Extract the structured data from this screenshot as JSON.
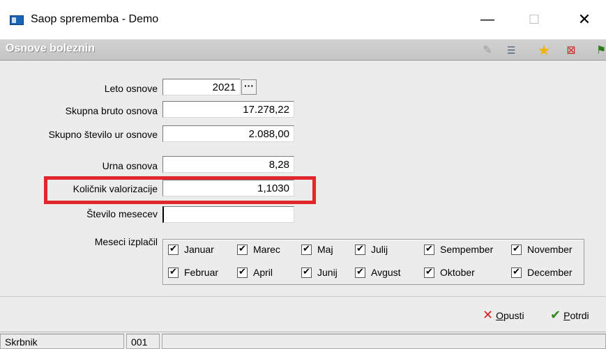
{
  "window": {
    "title": "Saop sprememba - Demo",
    "minimize_glyph": "—",
    "maximize_glyph": "☐",
    "close_glyph": "✕"
  },
  "header": {
    "title": "Osnove boleznin",
    "toolbar_icons": [
      "edit-icon",
      "list-icon",
      "star-icon",
      "delete-icon",
      "exit-icon"
    ]
  },
  "form": {
    "leto_osnove": {
      "label": "Leto osnove",
      "value": "2021",
      "button": "···"
    },
    "skupna_bruto_osnova": {
      "label": "Skupna bruto osnova",
      "value": "17.278,22"
    },
    "skupno_stevilo_ur": {
      "label": "Skupno število ur osnove",
      "value": "2.088,00"
    },
    "urna_osnova": {
      "label": "Urna osnova",
      "value": "8,28"
    },
    "kolicnik_valorizacije": {
      "label": "Količnik valorizacije",
      "value": "1,1030"
    },
    "stevilo_mesecev": {
      "label": "Število mesecev",
      "value": ""
    },
    "meseci_izplacil": {
      "label": "Meseci izplačil",
      "months": [
        {
          "label": "Januar",
          "checked": true
        },
        {
          "label": "Marec",
          "checked": true
        },
        {
          "label": "Maj",
          "checked": true
        },
        {
          "label": "Julij",
          "checked": true
        },
        {
          "label": "Sempember",
          "checked": true
        },
        {
          "label": "November",
          "checked": true
        },
        {
          "label": "Februar",
          "checked": true
        },
        {
          "label": "April",
          "checked": true
        },
        {
          "label": "Junij",
          "checked": true
        },
        {
          "label": "Avgust",
          "checked": true
        },
        {
          "label": "Oktober",
          "checked": true
        },
        {
          "label": "December",
          "checked": true
        }
      ]
    }
  },
  "actions": {
    "cancel_label": "Opusti",
    "ok_label": "Potrdi"
  },
  "statusbar": {
    "user": "Skrbnik",
    "code": "001"
  },
  "colors": {
    "highlight": "#e2272a",
    "header_band": "#c8c8c8",
    "form_bg": "#ececec"
  }
}
